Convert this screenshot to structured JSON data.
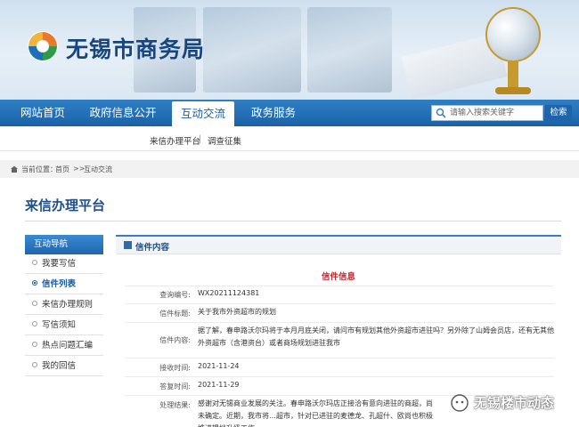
{
  "site": {
    "title": "无锡市商务局"
  },
  "nav": {
    "items": [
      "网站首页",
      "政府信息公开",
      "互动交流",
      "政务服务"
    ],
    "active_index": 2
  },
  "search": {
    "placeholder": "请输入搜索关键字",
    "button": "检索"
  },
  "subnav": {
    "items": [
      "来信办理平台",
      "调查征集"
    ],
    "separator": "|"
  },
  "breadcrumb": {
    "prefix": "当前位置：",
    "home": "首页",
    "sep": ">>",
    "current": "互动交流"
  },
  "page": {
    "title": "来信办理平台"
  },
  "sidebar": {
    "header": "互动导航",
    "items": [
      "我要写信",
      "信件列表",
      "来信办理规则",
      "写信须知",
      "热点问题汇编",
      "我的回信"
    ],
    "active_index": 1
  },
  "content": {
    "header": "信件内容",
    "letter_title": "信件信息",
    "fields": [
      {
        "label": "查询编号:",
        "value": "WX20211124381"
      },
      {
        "label": "信件标题:",
        "value": "关于我市外资超市的规划"
      },
      {
        "label": "信件内容:",
        "value": "据了解，春申路沃尔玛将于本月月底关闭，请问市有规划其他外资超市进驻吗？另外除了山姆会员店，还有无其他外资超市（含港资台）或者商场规划进驻我市"
      },
      {
        "label": "接收时间:",
        "value": "2021-11-24"
      },
      {
        "label": "答复时间:",
        "value": "2021-11-29"
      },
      {
        "label": "处理结果:",
        "value": "感谢对无锡商业发展的关注。春申路沃尔玛店正接洽有意向进驻的商超，尚未确定。近期，我市将…超市，针对已进驻的麦德龙、孔超什、欧尚也积极推进提档升级工作。"
      }
    ]
  },
  "watermark": {
    "text": "无锡楼市动态"
  },
  "colors": {
    "nav_blue": "#1a62a8",
    "title_blue": "#17457e",
    "letter_red": "#c1272d"
  }
}
